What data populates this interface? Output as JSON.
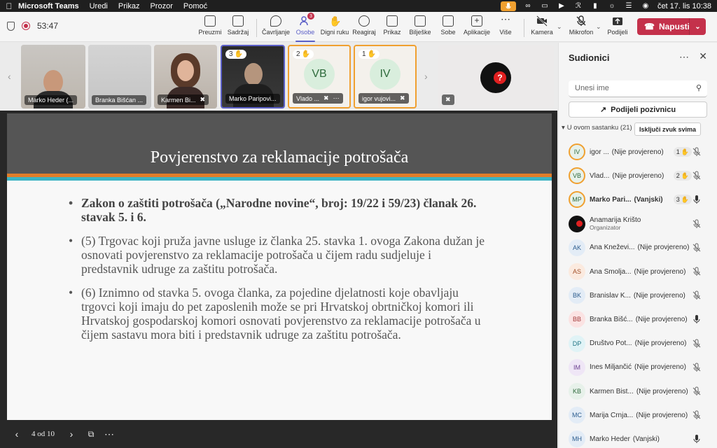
{
  "menubar": {
    "app": "Microsoft Teams",
    "items": [
      "Uredi",
      "Prikaz",
      "Prozor",
      "Pomoć"
    ],
    "clock": "čet 17. lis  10:38"
  },
  "toolbar": {
    "timer": "53:47",
    "buttons": [
      {
        "label": "Preuzmi",
        "icon": "take-control-icon"
      },
      {
        "label": "Sadržaj",
        "icon": "share-content-icon"
      },
      {
        "label": "Čavrljanje",
        "icon": "chat-icon"
      },
      {
        "label": "Osobe",
        "icon": "people-icon",
        "badge": "3"
      },
      {
        "label": "Digni ruku",
        "icon": "raise-hand-icon"
      },
      {
        "label": "Reagiraj",
        "icon": "react-icon"
      },
      {
        "label": "Prikaz",
        "icon": "view-icon"
      },
      {
        "label": "Bilješke",
        "icon": "notes-icon"
      },
      {
        "label": "Sobe",
        "icon": "rooms-icon"
      },
      {
        "label": "Aplikacije",
        "icon": "apps-icon"
      },
      {
        "label": "Više",
        "icon": "more-icon"
      },
      {
        "label": "Kamera",
        "icon": "camera-off-icon"
      },
      {
        "label": "Mikrofon",
        "icon": "mic-off-icon"
      },
      {
        "label": "Podijeli",
        "icon": "share-icon"
      }
    ],
    "leave_label": "Napusti"
  },
  "gallery": [
    {
      "name": "Marko Heder (...",
      "type": "photo"
    },
    {
      "name": "Branka Bišćan ...",
      "type": "photo"
    },
    {
      "name": "Karmen Bi...",
      "type": "photo"
    },
    {
      "name": "Marko Paripovi...",
      "type": "photo",
      "hand": "3"
    },
    {
      "name": "Vlado ...",
      "initials": "VB",
      "hand": "2"
    },
    {
      "name": "igor vujovi...",
      "initials": "IV",
      "hand": "1"
    },
    {
      "name": "",
      "type": "logo"
    }
  ],
  "slide": {
    "title": "Povjerenstvo za reklamacije potrošača",
    "bullets": [
      "Zakon o zaštiti potrošača  („Narodne novine“, broj: 19/22 i 59/23) članak 26. stavak 5. i 6.",
      "(5) Trgovac koji pruža javne usluge iz članka 25. stavka 1. ovoga Zakona dužan je osnovati povjerenstvo za reklamacije potrošača u čijem radu sudjeluje i predstavnik udruge za zaštitu potrošača.",
      "(6) Iznimno od stavka 5. ovoga članka, za pojedine djelatnosti koje obavljaju trgovci koji imaju do pet zaposlenih može se pri Hrvatskoj obrtničkoj komori ili Hrvatskoj gospodarskoj komori osnovati povjerenstvo za reklamacije potrošača u čijem sastavu mora biti i predstavnik udruge za zaštitu potrošača."
    ],
    "page": "4 od 10"
  },
  "panel": {
    "title": "Sudionici",
    "search_placeholder": "Unesi ime",
    "share_label": "Podijeli pozivnicu",
    "section_label": "U ovom sastanku (21)",
    "mute_all_label": "Isključi zvuk svima",
    "participants": [
      {
        "initials": "IV",
        "name": "igor ...",
        "tag": "(Nije provjereno)",
        "hand": "1",
        "mic": "off",
        "bg": "#e7f1ea",
        "fg": "#2f6b3d",
        "ring": true
      },
      {
        "initials": "VB",
        "name": "Vlad...",
        "tag": "(Nije provjereno)",
        "hand": "2",
        "mic": "off",
        "bg": "#e7f1ea",
        "fg": "#2f6b3d",
        "ring": true
      },
      {
        "initials": "MP",
        "name": "Marko Pari...",
        "tag": "(Vanjski)",
        "hand": "3",
        "mic": "on",
        "bg": "#e7f1ea",
        "fg": "#2f6b3d",
        "ring": true,
        "bold": true
      },
      {
        "initials": "",
        "name": "Anamarija Krišto",
        "sub": "Organizator",
        "mic": "off",
        "logo": true
      },
      {
        "initials": "AK",
        "name": "Ana Kneževi...",
        "tag": "(Nije provjereno)",
        "mic": "off",
        "bg": "#e3ecf6",
        "fg": "#2c5d8f"
      },
      {
        "initials": "AS",
        "name": "Ana Smolja...",
        "tag": "(Nije provjereno)",
        "mic": "off",
        "bg": "#fbeadf",
        "fg": "#a4522b"
      },
      {
        "initials": "BK",
        "name": "Branislav K...",
        "tag": "(Nije provjereno)",
        "mic": "off",
        "bg": "#e3ecf6",
        "fg": "#2c5d8f"
      },
      {
        "initials": "BB",
        "name": "Branka Bišć...",
        "tag": "(Nije provjereno)",
        "mic": "on",
        "bg": "#fbe3e3",
        "fg": "#a33a3a"
      },
      {
        "initials": "DP",
        "name": "Društvo Pot...",
        "tag": "(Nije provjereno)",
        "mic": "off",
        "bg": "#e0f3f6",
        "fg": "#1f7584"
      },
      {
        "initials": "IM",
        "name": "Ines Miljančić",
        "tag": "(Nije provjereno)",
        "mic": "off",
        "bg": "#efe6f6",
        "fg": "#6a3d8f"
      },
      {
        "initials": "KB",
        "name": "Karmen Bist...",
        "tag": "(Nije provjereno)",
        "mic": "off",
        "bg": "#e7f1ea",
        "fg": "#2f6b3d"
      },
      {
        "initials": "MC",
        "name": "Marija Crnja...",
        "tag": "(Nije provjereno)",
        "mic": "off",
        "bg": "#e3ecf6",
        "fg": "#2c5d8f"
      },
      {
        "initials": "MH",
        "name": "Marko Heder",
        "tag": "(Vanjski)",
        "mic": "on",
        "bg": "#e3ecf6",
        "fg": "#2c5d8f"
      }
    ]
  },
  "colors": {
    "accent": "#5b5fc7",
    "leave": "#c4314b",
    "hand": "#f0a030"
  }
}
